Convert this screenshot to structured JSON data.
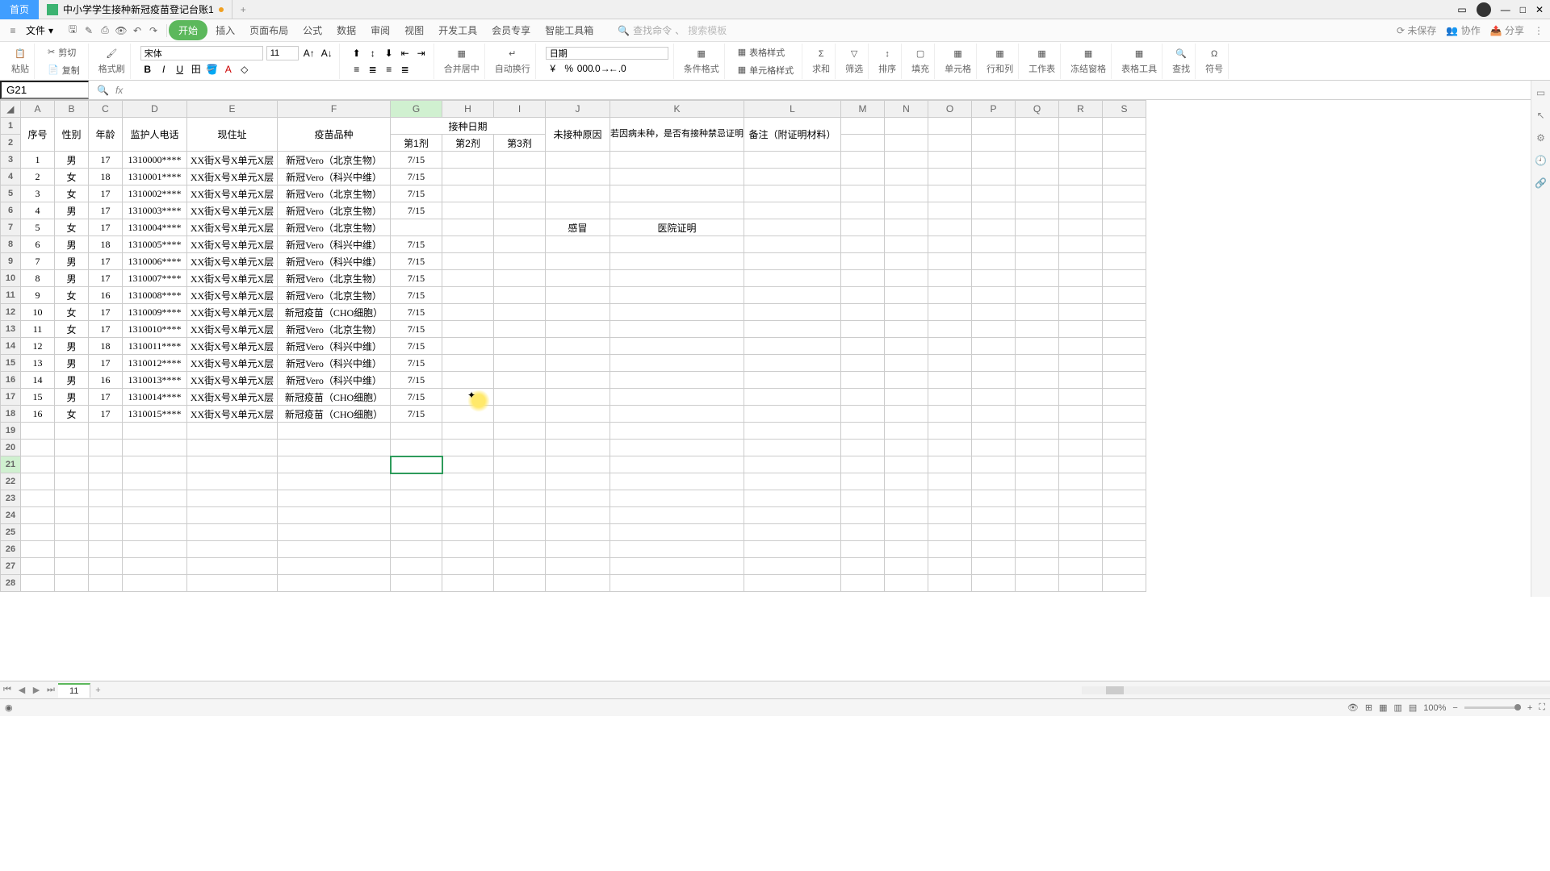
{
  "titlebar": {
    "home": "首页",
    "doc_name": "中小学学生接种新冠疫苗登记台账1",
    "add": "+"
  },
  "menubar": {
    "file": "文件",
    "tabs": [
      "开始",
      "插入",
      "页面布局",
      "公式",
      "数据",
      "审阅",
      "视图",
      "开发工具",
      "会员专享",
      "智能工具箱"
    ],
    "search_label": "查找命令",
    "search_placeholder": "搜索模板",
    "right": {
      "unsaved": "未保存",
      "collab": "协作",
      "share": "分享"
    }
  },
  "ribbon": {
    "paste": "粘贴",
    "cut": "剪切",
    "copy": "复制",
    "formatbrush": "格式刷",
    "font_name": "宋体",
    "font_size": "11",
    "merge": "合并居中",
    "wrap": "自动换行",
    "numfmt": "日期",
    "condfmt": "条件格式",
    "tablefmt": "表格样式",
    "cellfmt": "单元格样式",
    "sum": "求和",
    "filter": "筛选",
    "sort": "排序",
    "fill": "填充",
    "cells": "单元格",
    "rowcol": "行和列",
    "worksheet": "工作表",
    "freeze": "冻结窗格",
    "tabletool": "表格工具",
    "find": "查找",
    "symbol": "符号"
  },
  "refbar": {
    "cell": "G21",
    "fx": "fx"
  },
  "columns": {
    "letters": [
      "A",
      "B",
      "C",
      "D",
      "E",
      "F",
      "G",
      "H",
      "I",
      "J",
      "K",
      "L",
      "M",
      "N",
      "O",
      "P",
      "Q",
      "R",
      "S"
    ],
    "widths": [
      42,
      42,
      42,
      80,
      112,
      140,
      64,
      64,
      64,
      80,
      110,
      120,
      54,
      54,
      54,
      54,
      54,
      54,
      54
    ]
  },
  "headers": {
    "A": "序号",
    "B": "性别",
    "C": "年龄",
    "D": "监护人电话",
    "E": "现住址",
    "F": "疫苗品种",
    "GHI_top": "接种日期",
    "G": "第1剂",
    "H": "第2剂",
    "I": "第3剂",
    "J": "未接种原因",
    "K": "若因病未种，是否有接种禁忌证明",
    "L": "备注（附证明材料）"
  },
  "rows": [
    {
      "n": "1",
      "sex": "男",
      "age": "17",
      "tel": "1310000****",
      "addr": "XX街X号X单元X层",
      "vac": "新冠Vero（北京生物）",
      "d1": "7/15",
      "d2": "",
      "d3": "",
      "reason": "",
      "proof": "",
      "note": ""
    },
    {
      "n": "2",
      "sex": "女",
      "age": "18",
      "tel": "1310001****",
      "addr": "XX街X号X单元X层",
      "vac": "新冠Vero（科兴中维）",
      "d1": "7/15",
      "d2": "",
      "d3": "",
      "reason": "",
      "proof": "",
      "note": ""
    },
    {
      "n": "3",
      "sex": "女",
      "age": "17",
      "tel": "1310002****",
      "addr": "XX街X号X单元X层",
      "vac": "新冠Vero（北京生物）",
      "d1": "7/15",
      "d2": "",
      "d3": "",
      "reason": "",
      "proof": "",
      "note": ""
    },
    {
      "n": "4",
      "sex": "男",
      "age": "17",
      "tel": "1310003****",
      "addr": "XX街X号X单元X层",
      "vac": "新冠Vero（北京生物）",
      "d1": "7/15",
      "d2": "",
      "d3": "",
      "reason": "",
      "proof": "",
      "note": ""
    },
    {
      "n": "5",
      "sex": "女",
      "age": "17",
      "tel": "1310004****",
      "addr": "XX街X号X单元X层",
      "vac": "新冠Vero（北京生物）",
      "d1": "",
      "d2": "",
      "d3": "",
      "reason": "感冒",
      "proof": "医院证明",
      "note": ""
    },
    {
      "n": "6",
      "sex": "男",
      "age": "18",
      "tel": "1310005****",
      "addr": "XX街X号X单元X层",
      "vac": "新冠Vero（科兴中维）",
      "d1": "7/15",
      "d2": "",
      "d3": "",
      "reason": "",
      "proof": "",
      "note": ""
    },
    {
      "n": "7",
      "sex": "男",
      "age": "17",
      "tel": "1310006****",
      "addr": "XX街X号X单元X层",
      "vac": "新冠Vero（科兴中维）",
      "d1": "7/15",
      "d2": "",
      "d3": "",
      "reason": "",
      "proof": "",
      "note": ""
    },
    {
      "n": "8",
      "sex": "男",
      "age": "17",
      "tel": "1310007****",
      "addr": "XX街X号X单元X层",
      "vac": "新冠Vero（北京生物）",
      "d1": "7/15",
      "d2": "",
      "d3": "",
      "reason": "",
      "proof": "",
      "note": ""
    },
    {
      "n": "9",
      "sex": "女",
      "age": "16",
      "tel": "1310008****",
      "addr": "XX街X号X单元X层",
      "vac": "新冠Vero（北京生物）",
      "d1": "7/15",
      "d2": "",
      "d3": "",
      "reason": "",
      "proof": "",
      "note": ""
    },
    {
      "n": "10",
      "sex": "女",
      "age": "17",
      "tel": "1310009****",
      "addr": "XX街X号X单元X层",
      "vac": "新冠疫苗（CHO细胞）",
      "d1": "7/15",
      "d2": "",
      "d3": "",
      "reason": "",
      "proof": "",
      "note": ""
    },
    {
      "n": "11",
      "sex": "女",
      "age": "17",
      "tel": "1310010****",
      "addr": "XX街X号X单元X层",
      "vac": "新冠Vero（北京生物）",
      "d1": "7/15",
      "d2": "",
      "d3": "",
      "reason": "",
      "proof": "",
      "note": ""
    },
    {
      "n": "12",
      "sex": "男",
      "age": "18",
      "tel": "1310011****",
      "addr": "XX街X号X单元X层",
      "vac": "新冠Vero（科兴中维）",
      "d1": "7/15",
      "d2": "",
      "d3": "",
      "reason": "",
      "proof": "",
      "note": ""
    },
    {
      "n": "13",
      "sex": "男",
      "age": "17",
      "tel": "1310012****",
      "addr": "XX街X号X单元X层",
      "vac": "新冠Vero（科兴中维）",
      "d1": "7/15",
      "d2": "",
      "d3": "",
      "reason": "",
      "proof": "",
      "note": ""
    },
    {
      "n": "14",
      "sex": "男",
      "age": "16",
      "tel": "1310013****",
      "addr": "XX街X号X单元X层",
      "vac": "新冠Vero（科兴中维）",
      "d1": "7/15",
      "d2": "",
      "d3": "",
      "reason": "",
      "proof": "",
      "note": ""
    },
    {
      "n": "15",
      "sex": "男",
      "age": "17",
      "tel": "1310014****",
      "addr": "XX街X号X单元X层",
      "vac": "新冠疫苗（CHO细胞）",
      "d1": "7/15",
      "d2": "",
      "d3": "",
      "reason": "",
      "proof": "",
      "note": ""
    },
    {
      "n": "16",
      "sex": "女",
      "age": "17",
      "tel": "1310015****",
      "addr": "XX街X号X单元X层",
      "vac": "新冠疫苗（CHO细胞）",
      "d1": "7/15",
      "d2": "",
      "d3": "",
      "reason": "",
      "proof": "",
      "note": ""
    }
  ],
  "empty_row_count": 10,
  "sheettabs": {
    "active": "11",
    "add": "+"
  },
  "statusbar": {
    "zoom": "100%"
  }
}
